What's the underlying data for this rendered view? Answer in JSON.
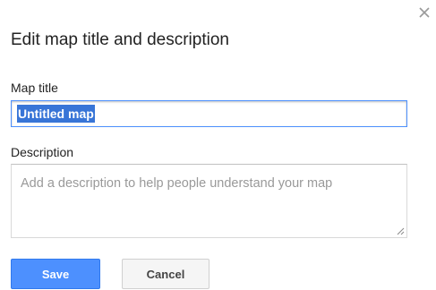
{
  "dialog": {
    "title": "Edit map title and description",
    "close_icon": "close-icon"
  },
  "map_title": {
    "label": "Map title",
    "value": "Untitled map",
    "selected": true
  },
  "description": {
    "label": "Description",
    "value": "",
    "placeholder": "Add a description to help people understand your map"
  },
  "buttons": {
    "save_label": "Save",
    "cancel_label": "Cancel"
  },
  "colors": {
    "accent": "#4d90fe",
    "selection": "#3875d7",
    "placeholder_text": "#999999"
  }
}
